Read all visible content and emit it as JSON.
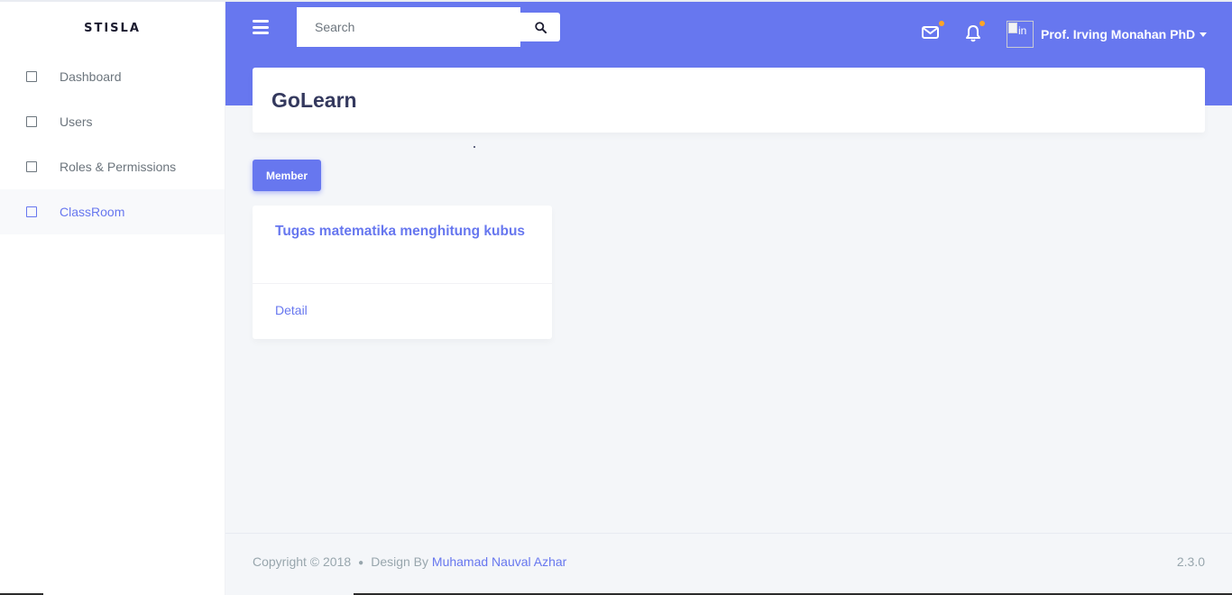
{
  "sidebar": {
    "brand": "STISLA",
    "items": [
      {
        "label": "Dashboard",
        "active": false
      },
      {
        "label": "Users",
        "active": false
      },
      {
        "label": "Roles & Permissions",
        "active": false
      },
      {
        "label": "ClassRoom",
        "active": true
      }
    ]
  },
  "navbar": {
    "search_placeholder": "Search",
    "user_name": "Prof. Irving Monahan PhD",
    "avatar_alt": "in",
    "colors": {
      "primary": "#6777ef",
      "notification_dot": "#ffa426"
    }
  },
  "main": {
    "section_title": "GoLearn",
    "member_button": "Member",
    "card": {
      "title": "Tugas matematika menghitung kubus",
      "link": "Detail"
    }
  },
  "footer": {
    "copyright": "Copyright © 2018",
    "design_by": "Design By",
    "author": "Muhamad Nauval Azhar",
    "version": "2.3.0"
  }
}
